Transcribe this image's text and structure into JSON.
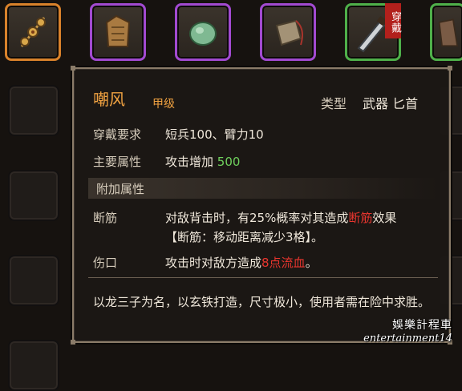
{
  "equipped_tag": "穿戴",
  "item": {
    "name": "嘲风",
    "grade": "甲级",
    "type_label": "类型",
    "type_value": "武器 匕首"
  },
  "requirements": {
    "label": "穿戴要求",
    "value": "短兵100、臂力10"
  },
  "main_attribute": {
    "label": "主要属性",
    "text": "攻击增加",
    "number": "500"
  },
  "extra_section": {
    "title": "附加属性"
  },
  "effects": [
    {
      "name": "断筋",
      "line1_pre": "对敌背击时，有25%概率对其造成",
      "line1_red": "断筋",
      "line1_post": "效果",
      "line2": "【断筋：移动距离减少3格】。"
    },
    {
      "name": "伤口",
      "line1_pre": "攻击时对敌方造成",
      "line1_red": "8点流血",
      "line1_post": "。"
    }
  ],
  "description": "以龙三子为名，以玄铁打造，尺寸极小，使用者需在险中求胜。",
  "watermark": {
    "line1": "娛樂計程車",
    "line2": "entertainment14"
  },
  "colors": {
    "name": "#f0a241",
    "green_value": "#6fd05d",
    "red_value": "#e8352e",
    "border_orange": "#d9822b",
    "border_purple": "#a24ad1",
    "border_green": "#4fb04a"
  }
}
